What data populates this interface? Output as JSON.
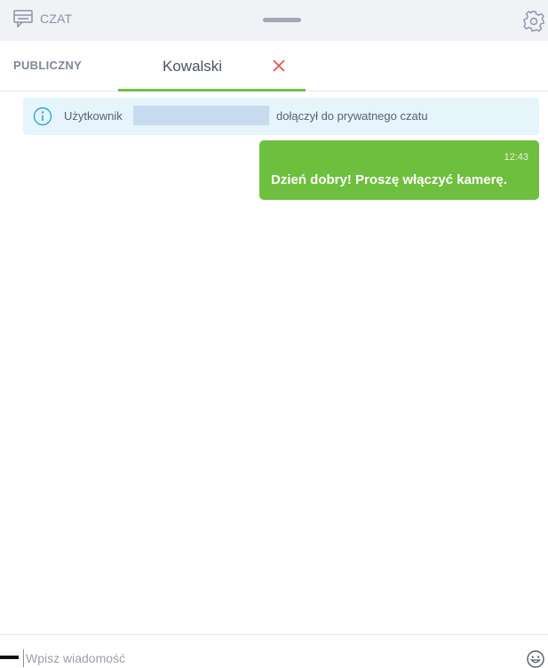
{
  "header": {
    "title": "CZAT",
    "icons": {
      "chat": "chat-window-icon",
      "settings": "gear-icon"
    }
  },
  "tabs": {
    "public_label": "PUBLICZNY",
    "private_label": "Kowalski",
    "close_icon": "close-icon"
  },
  "messages": {
    "system": {
      "prefix": "Użytkownik",
      "suffix": "dołączył do prywatnego czatu",
      "icon": "info-icon"
    },
    "items": [
      {
        "time": "12:43",
        "text": "Dzień dobry! Proszę włączyć kamerę."
      }
    ]
  },
  "composer": {
    "placeholder": "Wpisz wiadomość",
    "value": "",
    "emoji_icon": "emoji-icon"
  },
  "colors": {
    "accent": "#6cc04a",
    "bubble": "#6dbf3d",
    "close": "#e55353",
    "info": "#2aa8d8",
    "header_bg": "#f1f2f5"
  }
}
